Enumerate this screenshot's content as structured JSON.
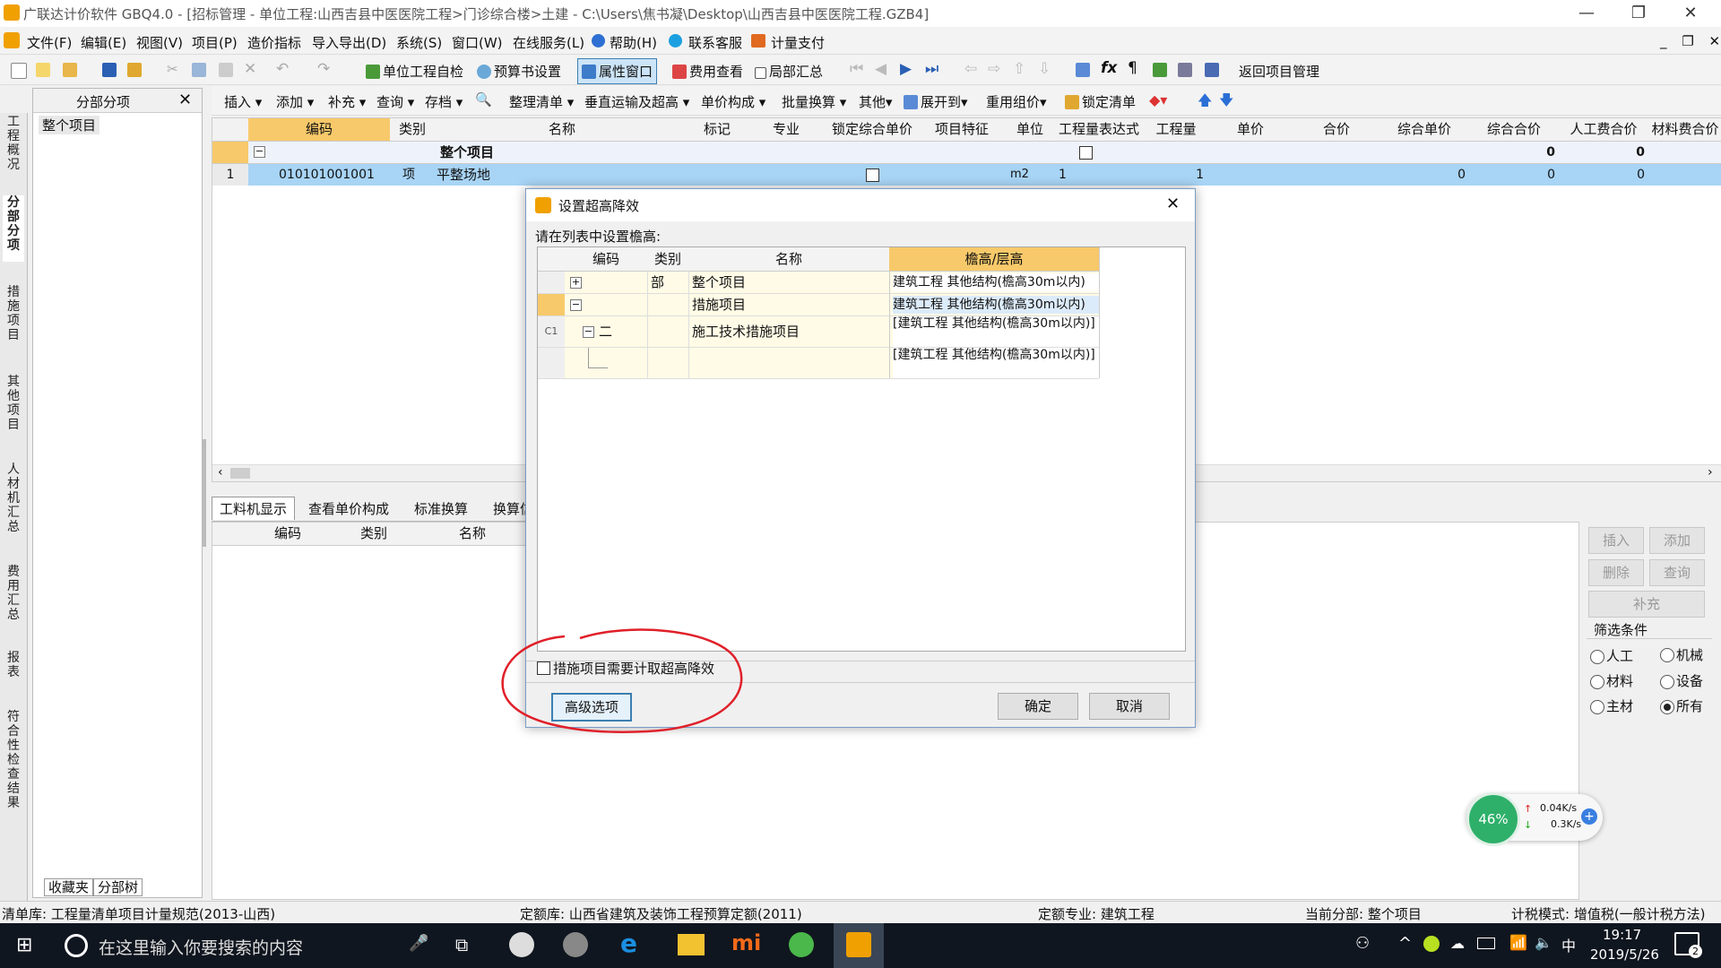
{
  "window": {
    "title": "广联达计价软件 GBQ4.0 - [招标管理 - 单位工程:山西吉县中医医院工程>门诊综合楼>土建 - C:\\Users\\焦书凝\\Desktop\\山西吉县中医医院工程.GZB4]",
    "minimize": "—",
    "restore": "❐",
    "close": "✕",
    "mdi_controls": "_ ❐ ✕"
  },
  "menu": [
    "文件(F)",
    "编辑(E)",
    "视图(V)",
    "项目(P)",
    "造价指标",
    "导入导出(D)",
    "系统(S)",
    "窗口(W)",
    "在线服务(L)",
    "帮助(H)",
    "联系客服",
    "计量支付"
  ],
  "toolbar1": {
    "self_check": "单位工程自检",
    "budget_settings": "预算书设置",
    "property_window": "属性窗口",
    "fee_view": "费用查看",
    "partial_summary": "局部汇总",
    "return_project": "返回项目管理"
  },
  "toolbar2": [
    "插入",
    "添加",
    "补充",
    "查询",
    "存档",
    "整理清单",
    "垂直运输及超高",
    "单价构成",
    "批量换算",
    "其他",
    "展开到",
    "重用组价",
    "锁定清单"
  ],
  "vtabs": [
    "工程概况",
    "分部分项",
    "措施项目",
    "其他项目",
    "人材机汇总",
    "费用汇总",
    "报表",
    "符合性检查结果"
  ],
  "left_panel": {
    "title": "分部分项",
    "close": "✕",
    "root": "整个项目",
    "tabs": [
      "收藏夹",
      "分部树"
    ]
  },
  "grid": {
    "headers": [
      "编码",
      "类别",
      "名称",
      "标记",
      "专业",
      "锁定综合单价",
      "项目特征",
      "单位",
      "工程量表达式",
      "工程量",
      "单价",
      "合价",
      "综合单价",
      "综合合价",
      "人工费合价",
      "材料费合价"
    ],
    "summary": {
      "name": "整个项目",
      "zhhj": "0",
      "rgfhj": "0"
    },
    "rows": [
      {
        "no": "1",
        "code": "010101001001",
        "type": "项",
        "name": "平整场地",
        "unit": "m2",
        "expr": "1",
        "qty": "1",
        "zhdj": "0",
        "zhhj": "0",
        "rgfhj": "0"
      }
    ]
  },
  "bottom_tabs": [
    "工料机显示",
    "查看单价构成",
    "标准换算",
    "换算信"
  ],
  "bottom_headers": [
    "编码",
    "类别",
    "名称"
  ],
  "right_panel": {
    "buttons": [
      "插入",
      "添加",
      "删除",
      "查询",
      "补充"
    ],
    "filter_title": "筛选条件",
    "filters": [
      {
        "label": "人工",
        "selected": false
      },
      {
        "label": "机械",
        "selected": false
      },
      {
        "label": "材料",
        "selected": false
      },
      {
        "label": "设备",
        "selected": false
      },
      {
        "label": "主材",
        "selected": false
      },
      {
        "label": "所有",
        "selected": true
      }
    ]
  },
  "net_widget": {
    "percent": "46%",
    "up": "0.04K/s",
    "down": "0.3K/s"
  },
  "dialog": {
    "title": "设置超高降效",
    "close": "✕",
    "prompt": "请在列表中设置檐高:",
    "headers": [
      "编码",
      "类别",
      "名称",
      "檐高/层高"
    ],
    "rows": [
      {
        "rowlabel": "",
        "toggle": "+",
        "code": "",
        "type": "部",
        "name": "整个项目",
        "height": "建筑工程 其他结构(檐高30m以内)"
      },
      {
        "rowlabel": "",
        "toggle": "−",
        "code": "",
        "type": "",
        "name": "措施项目",
        "height": "建筑工程 其他结构(檐高30m以内)"
      },
      {
        "rowlabel": "C1",
        "toggle": "−",
        "code": "二",
        "type": "",
        "name": "施工技术措施项目",
        "height": "[建筑工程 其他结构(檐高30m以内)]"
      },
      {
        "rowlabel": "",
        "toggle": "",
        "code": "",
        "type": "",
        "name": "",
        "height": "[建筑工程 其他结构(檐高30m以内)]"
      }
    ],
    "checkbox_label": "措施项目需要计取超高降效",
    "advanced": "高级选项",
    "ok": "确定",
    "cancel": "取消"
  },
  "status": {
    "qdk": "清单库: 工程量清单项目计量规范(2013-山西)",
    "dek": "定额库: 山西省建筑及装饰工程预算定额(2011)",
    "dezy": "定额专业: 建筑工程",
    "dqfb": "当前分部: 整个项目",
    "jsms": "计税模式: 增值税(一般计税方法)"
  },
  "taskbar": {
    "search_placeholder": "在这里输入你要搜索的内容",
    "time": "19:17",
    "date": "2019/5/26",
    "ime": "中",
    "notif_count": "2"
  },
  "colors": {
    "accent_header": "#f7c96a",
    "selected_row": "#a8d4f5",
    "annotation": "#e0202a"
  }
}
